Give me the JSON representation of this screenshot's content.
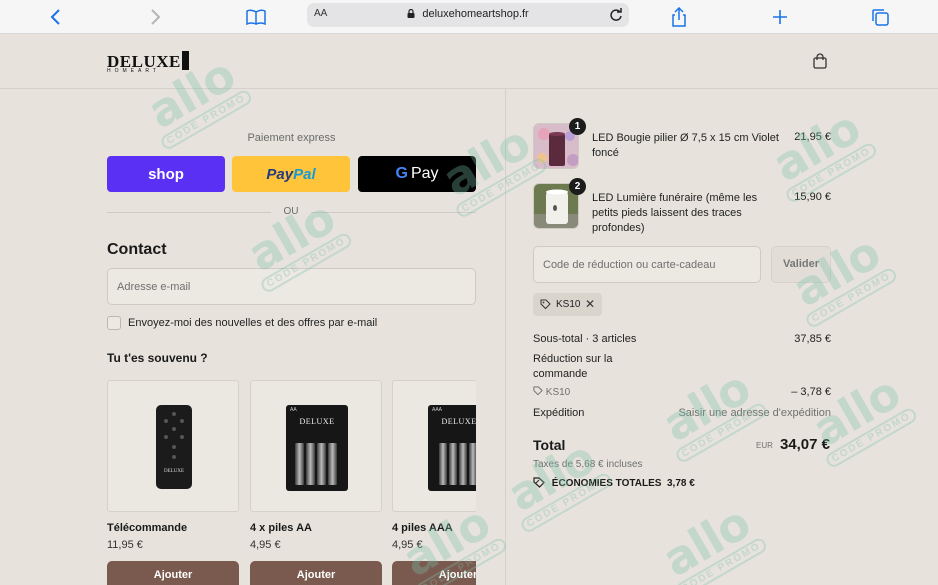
{
  "browser": {
    "url_aa": "AA",
    "url": "deluxehomeartshop.fr"
  },
  "header": {
    "logo_main": "DELUXE",
    "logo_sub": "HOMEART"
  },
  "express": {
    "label": "Paiement express",
    "shop_label": "shop",
    "paypal_part1": "Pay",
    "paypal_part2": "Pal",
    "gpay_g": "G",
    "gpay_label": "Pay",
    "or": "OU"
  },
  "contact": {
    "title": "Contact",
    "email_placeholder": "Adresse e-mail",
    "newsletter_label": "Envoyez-moi des nouvelles et des offres par e-mail"
  },
  "recommendations": {
    "title": "Tu t'es souvenu ?",
    "products": [
      {
        "name": "Télécommande",
        "price": "11,95 €",
        "button": "Ajouter",
        "image_label": "",
        "image_logo": "DELUXE"
      },
      {
        "name": "4 x piles AA",
        "price": "4,95 €",
        "button": "Ajouter",
        "image_label": "AA",
        "image_logo": "DELUXE"
      },
      {
        "name": "4 piles AAA",
        "price": "4,95 €",
        "button": "Ajouter",
        "image_label": "AAA",
        "image_logo": "DELUXE"
      }
    ]
  },
  "order": {
    "items": [
      {
        "qty": "1",
        "name": "LED Bougie pilier Ø 7,5 x 15 cm Violet foncé",
        "price": "21,95 €"
      },
      {
        "qty": "2",
        "name": "LED Lumière funéraire (même les petits pieds laissent des traces profondes)",
        "price": "15,90 €"
      }
    ],
    "discount_placeholder": "Code de réduction ou carte-cadeau",
    "validate_label": "Valider",
    "applied_code": "KS10",
    "subtotal_label": "Sous-total · 3 articles",
    "subtotal_value": "37,85 €",
    "reduction_label": "Réduction sur la commande",
    "reduction_code": "KS10",
    "reduction_value": "– 3,78 €",
    "shipping_label": "Expédition",
    "shipping_value": "Saisir une adresse d'expédition",
    "total_label": "Total",
    "total_currency": "EUR",
    "total_value": "34,07 €",
    "tax_note": "Taxes de 5,68 € incluses",
    "savings_label": "ÉCONOMIES TOTALES",
    "savings_value": "3,78 €"
  },
  "watermark": {
    "main": "allo",
    "sub": "CODE PROMO"
  },
  "colors": {
    "shop": "#5a31f4",
    "paypal": "#ffc439",
    "gpay": "#000000",
    "add_button": "#7a5a4e",
    "background": "#e7e3dc"
  }
}
